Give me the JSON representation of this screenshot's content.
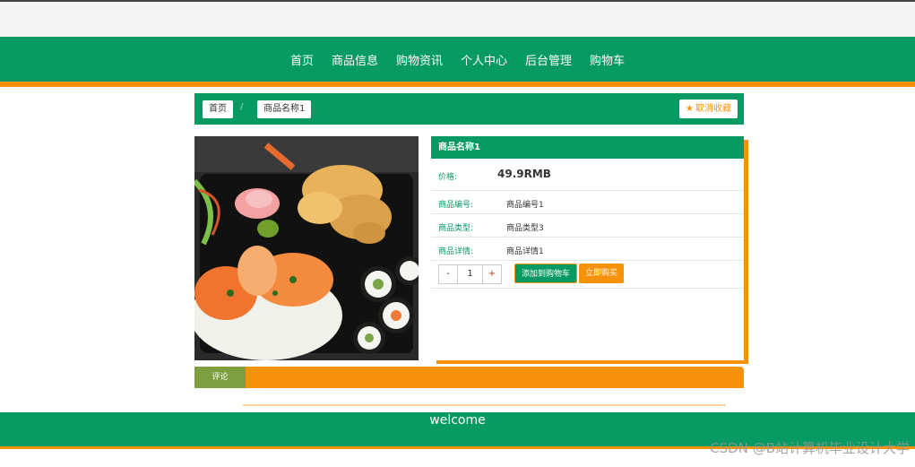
{
  "nav": {
    "items": [
      {
        "label": "首页"
      },
      {
        "label": "商品信息"
      },
      {
        "label": "购物资讯"
      },
      {
        "label": "个人中心"
      },
      {
        "label": "后台管理"
      },
      {
        "label": "购物车"
      }
    ]
  },
  "breadcrumb": {
    "home": "首页",
    "separator": "/",
    "current": "商品名称1",
    "favorite": "取消收藏"
  },
  "product": {
    "title": "商品名称1",
    "price_label": "价格:",
    "price": "49.9RMB",
    "fields": [
      {
        "label": "商品编号:",
        "value": "商品编号1"
      },
      {
        "label": "商品类型:",
        "value": "商品类型3"
      },
      {
        "label": "商品详情:",
        "value": "商品详情1"
      }
    ],
    "qty_minus": "-",
    "quantity": "1",
    "qty_plus": "+",
    "add_to_cart": "添加到购物车",
    "buy_now": "立即购买"
  },
  "tabs": {
    "comment": "评论"
  },
  "footer": {
    "text": "welcome"
  },
  "watermark": "CSDN @B站计算机毕业设计大学",
  "colors": {
    "primary": "#089a63",
    "accent": "#f6920a",
    "price": "#e13a1a"
  }
}
